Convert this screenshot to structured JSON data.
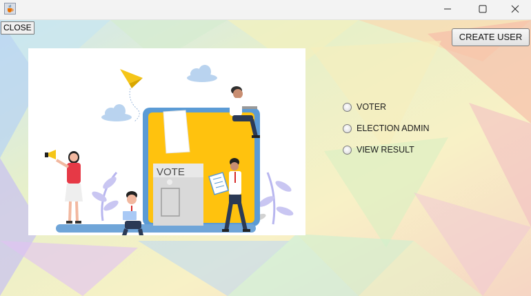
{
  "window": {
    "icon": "java-cup-icon",
    "controls": {
      "minimize_icon": "minimize-icon",
      "maximize_icon": "maximize-icon",
      "close_icon": "close-icon"
    }
  },
  "toolbar": {
    "close_label": "CLOSE",
    "create_user_label": "CREATE USER"
  },
  "illustration": {
    "sign_text": "VOTE"
  },
  "options": [
    {
      "label": "VOTER",
      "selected": false
    },
    {
      "label": "ELECTION ADMIN",
      "selected": false
    },
    {
      "label": "VIEW RESULT",
      "selected": false
    }
  ],
  "colors": {
    "laptop_yellow": "#ffc20e",
    "laptop_frame": "#5b9bd5",
    "plane": "#f5c518"
  }
}
